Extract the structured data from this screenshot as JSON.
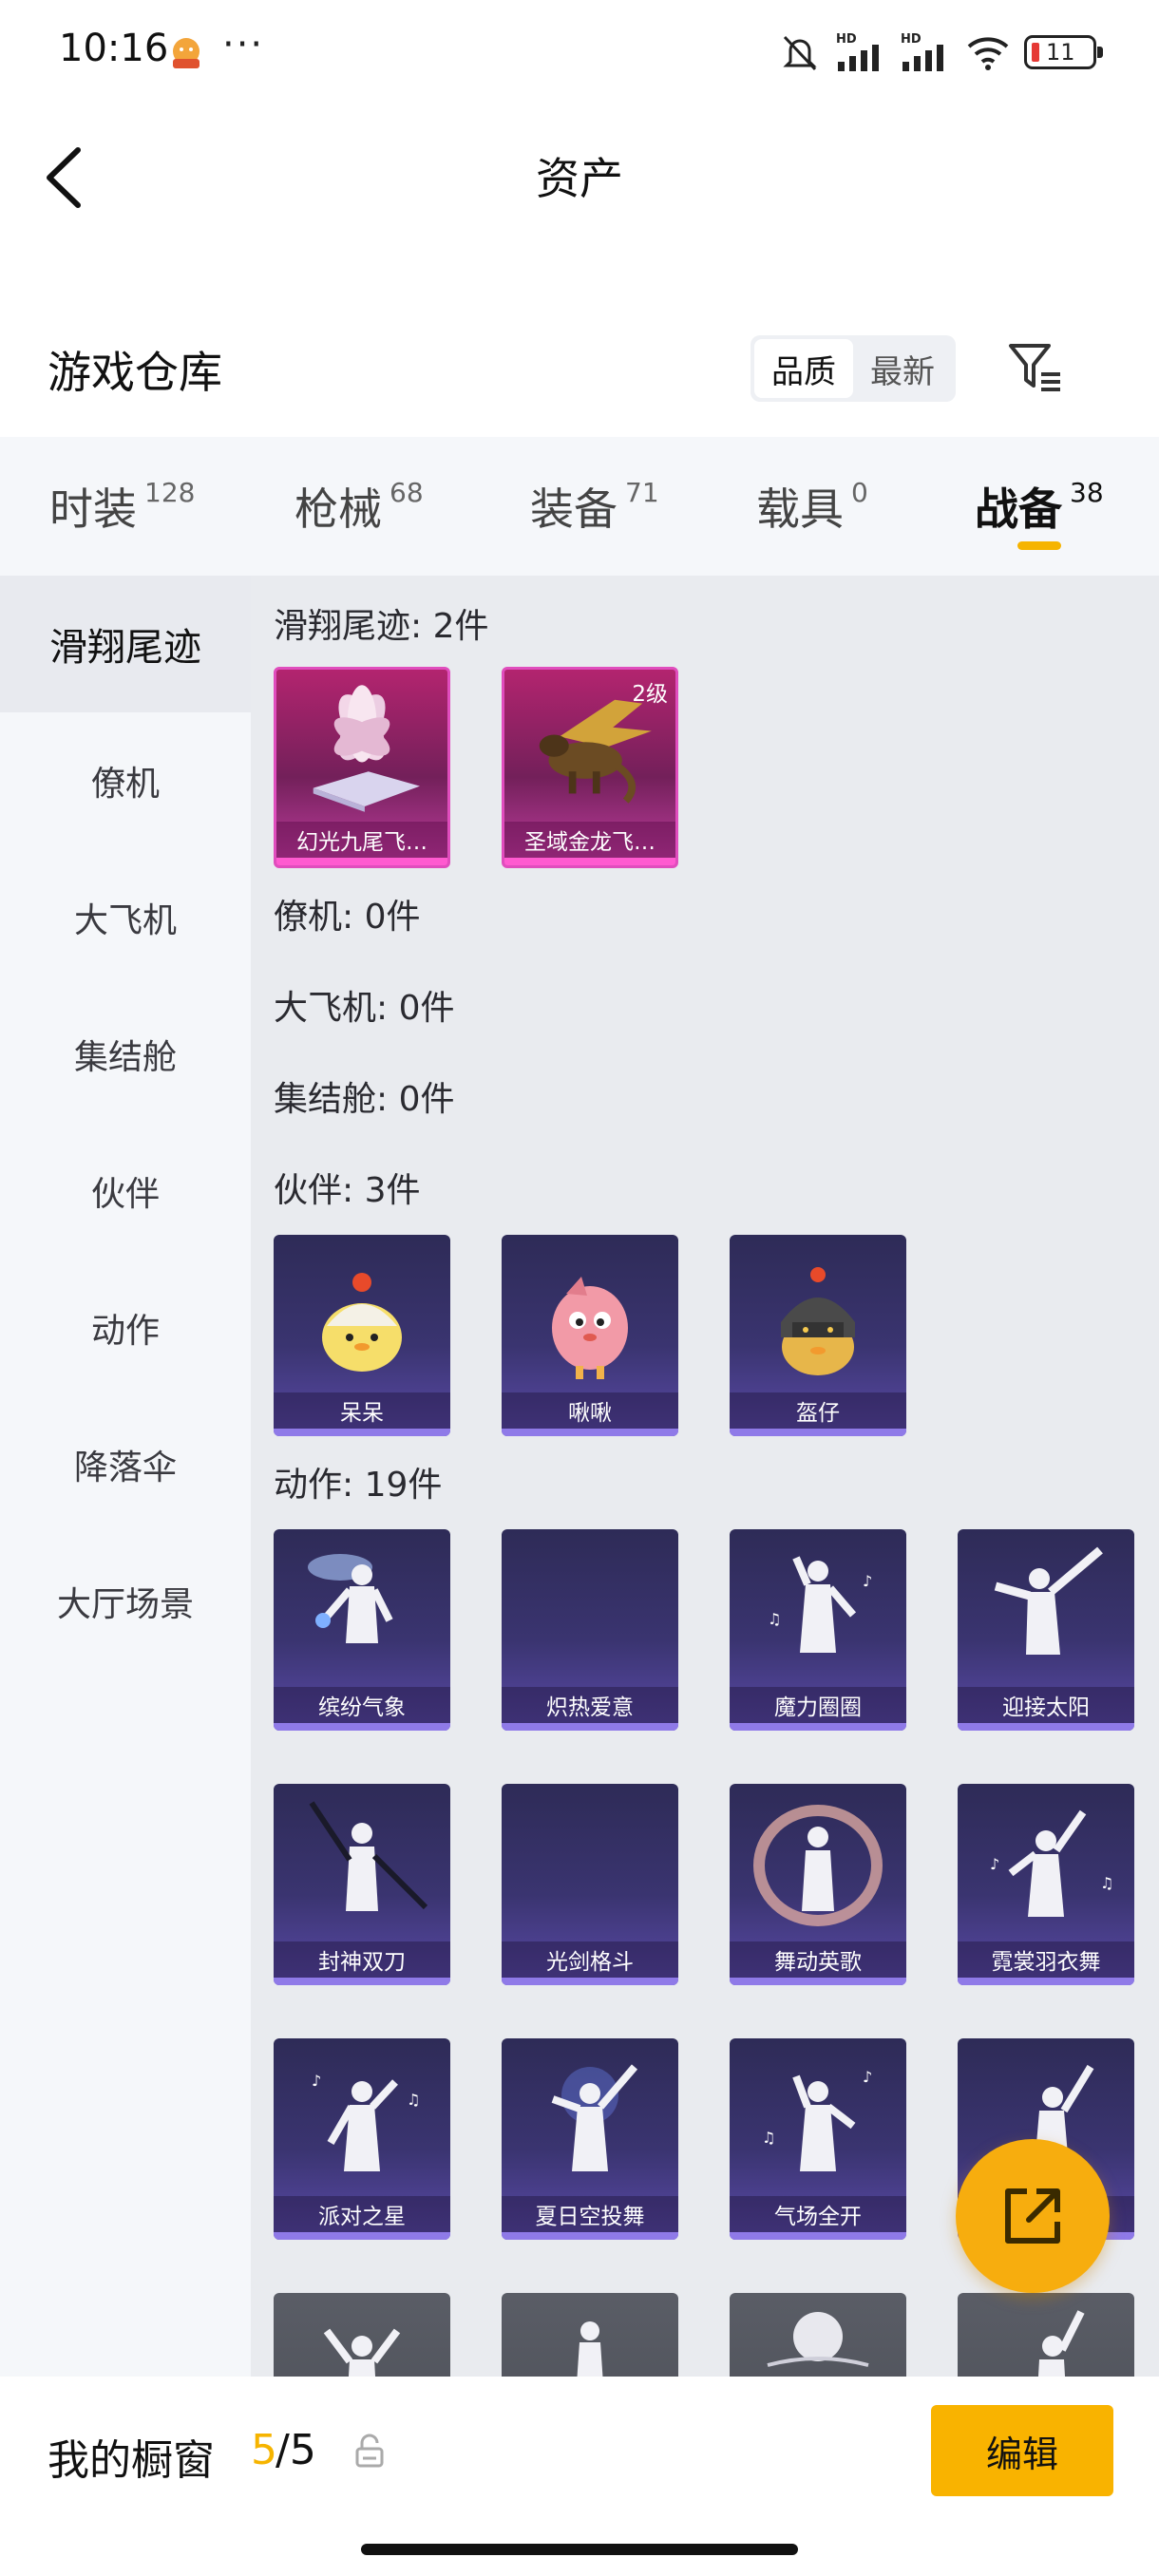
{
  "status_bar": {
    "time": "10:16",
    "dots": "···",
    "battery_level": "11",
    "icons": [
      "app-notification-icon",
      "mute-icon",
      "signal-hd-icon",
      "signal-hd-icon",
      "wifi-icon",
      "battery-icon"
    ]
  },
  "header": {
    "title": "资产",
    "back_icon": "chevron-left-icon"
  },
  "warehouse": {
    "title": "游戏仓库",
    "sort_options": [
      "品质",
      "最新"
    ],
    "sort_selected": "品质",
    "filter_icon": "filter-icon"
  },
  "tabs": [
    {
      "label": "时装",
      "count": "128"
    },
    {
      "label": "枪械",
      "count": "68"
    },
    {
      "label": "装备",
      "count": "71"
    },
    {
      "label": "载具",
      "count": "0"
    },
    {
      "label": "战备",
      "count": "38",
      "active": true
    }
  ],
  "sidebar": {
    "items": [
      "滑翔尾迹",
      "僚机",
      "大飞机",
      "集结舱",
      "伙伴",
      "动作",
      "降落伞",
      "大厅场景"
    ],
    "active": "滑翔尾迹"
  },
  "sections": {
    "glide_trail": {
      "label": "滑翔尾迹: 2件",
      "items": [
        {
          "name": "幻光九尾飞…"
        },
        {
          "name": "圣域金龙飞…",
          "level": "2级"
        }
      ]
    },
    "wingman": {
      "label": "僚机: 0件"
    },
    "big_plane": {
      "label": "大飞机: 0件"
    },
    "assembly": {
      "label": "集结舱: 0件"
    },
    "partner": {
      "label": "伙伴: 3件",
      "items": [
        {
          "name": "呆呆"
        },
        {
          "name": "啾啾"
        },
        {
          "name": "盔仔"
        }
      ]
    },
    "emote": {
      "label": "动作: 19件",
      "items": [
        {
          "name": "缤纷气象"
        },
        {
          "name": "炽热爱意"
        },
        {
          "name": "魔力圈圈"
        },
        {
          "name": "迎接太阳"
        },
        {
          "name": "封神双刀"
        },
        {
          "name": "光剑格斗"
        },
        {
          "name": "舞动英歌"
        },
        {
          "name": "霓裳羽衣舞"
        },
        {
          "name": "派对之星"
        },
        {
          "name": "夏日空投舞"
        },
        {
          "name": "气场全开"
        },
        {
          "name": ""
        }
      ]
    }
  },
  "bottom_bar": {
    "label": "我的橱窗",
    "used": "5",
    "total": "/5",
    "edit_label": "编辑"
  },
  "colors": {
    "accent": "#f6b400",
    "card_pink": "#b3246f",
    "card_purple": "#3a3470"
  }
}
